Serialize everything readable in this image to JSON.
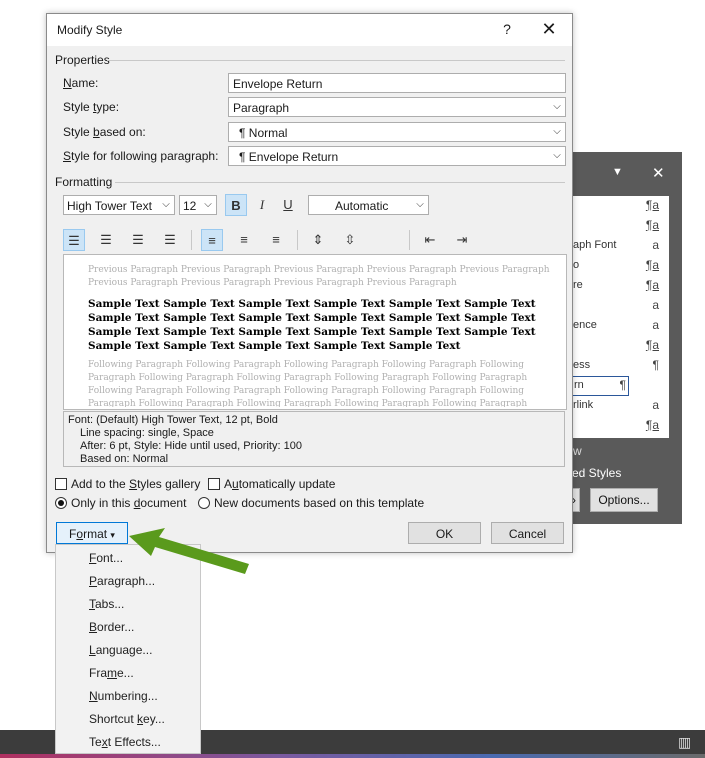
{
  "styles_pane": {
    "rows": [
      {
        "name": "",
        "mark": "¶a"
      },
      {
        "name": "",
        "mark": "¶a"
      },
      {
        "name": "aph Font",
        "mark": "a"
      },
      {
        "name": "o",
        "mark": "¶a"
      },
      {
        "name": "re",
        "mark": "¶a"
      },
      {
        "name": "",
        "mark": "a"
      },
      {
        "name": "ence",
        "mark": "a"
      },
      {
        "name": "",
        "mark": "¶a"
      },
      {
        "name": "ess",
        "mark": "¶"
      },
      {
        "name": "rn",
        "mark": "¶"
      },
      {
        "name": "rlink",
        "mark": "a"
      },
      {
        "name": "",
        "mark": "¶a"
      }
    ],
    "footer_line1": "w",
    "footer_line2": "ed Styles",
    "options_label": "Options..."
  },
  "dialog": {
    "title": "Modify Style",
    "help_glyph": "?",
    "close_glyph": "✕",
    "properties_heading": "Properties",
    "name_label_pre": "",
    "name_label_key": "N",
    "name_label_post": "ame:",
    "name_value": "Envelope Return",
    "style_type_label_pre": "Style ",
    "style_type_label_key": "t",
    "style_type_label_post": "ype:",
    "style_type_value": "Paragraph",
    "based_on_label_pre": "Style ",
    "based_on_label_key": "b",
    "based_on_label_post": "ased on:",
    "based_on_value": "¶  Normal",
    "following_label_pre": "",
    "following_label_key": "S",
    "following_label_post": "tyle for following paragraph:",
    "following_value": "¶  Envelope Return",
    "formatting_heading": "Formatting",
    "font_value": "High Tower Text",
    "size_value": "12",
    "bold_glyph": "B",
    "italic_glyph": "I",
    "underline_glyph": "U",
    "color_value": "Automatic",
    "preview_prev": "Previous Paragraph Previous Paragraph Previous Paragraph Previous Paragraph Previous Paragraph Previous Paragraph Previous Paragraph Previous Paragraph Previous Paragraph",
    "preview_sample": "Sample Text Sample Text Sample Text Sample Text Sample Text Sample Text Sample Text Sample Text Sample Text Sample Text Sample Text Sample Text Sample Text Sample Text Sample Text Sample Text Sample Text Sample Text Sample Text Sample Text Sample Text Sample Text Sample Text",
    "preview_follow": "Following Paragraph Following Paragraph Following Paragraph Following Paragraph Following Paragraph Following Paragraph Following Paragraph Following Paragraph Following Paragraph Following Paragraph Following Paragraph Following Paragraph Following Paragraph Following Paragraph Following Paragraph Following Paragraph Following Paragraph Following Paragraph Following Paragraph Following Paragraph",
    "desc_line1": "Font: (Default) High Tower Text, 12 pt, Bold",
    "desc_line2": "Line spacing:  single, Space",
    "desc_line3": "After:  6 pt, Style: Hide until used, Priority: 100",
    "desc_line4": "Based on: Normal",
    "add_gallery_pre": "Add to the ",
    "add_gallery_key": "S",
    "add_gallery_post": "tyles gallery",
    "auto_update_pre": "A",
    "auto_update_key": "u",
    "auto_update_post": "tomatically update",
    "only_doc_pre": "Only in this ",
    "only_doc_key": "d",
    "only_doc_post": "ocument",
    "new_docs_label": "New documents based on this template",
    "format_pre": "F",
    "format_key": "o",
    "format_post": "rmat",
    "format_caret": "▾",
    "ok_label": "OK",
    "cancel_label": "Cancel"
  },
  "menu": {
    "items": [
      {
        "pre": "",
        "key": "F",
        "post": "ont..."
      },
      {
        "pre": "",
        "key": "P",
        "post": "aragraph..."
      },
      {
        "pre": "",
        "key": "T",
        "post": "abs..."
      },
      {
        "pre": "",
        "key": "B",
        "post": "order..."
      },
      {
        "pre": "",
        "key": "L",
        "post": "anguage..."
      },
      {
        "pre": "Fra",
        "key": "m",
        "post": "e..."
      },
      {
        "pre": "",
        "key": "N",
        "post": "umbering..."
      },
      {
        "pre": "Shortcut ",
        "key": "k",
        "post": "ey..."
      },
      {
        "pre": "Te",
        "key": "x",
        "post": "t Effects..."
      }
    ]
  },
  "colors": {
    "arrow": "#5a9a1c",
    "accent": "#0078d7",
    "highlight": "#cce4f7"
  }
}
